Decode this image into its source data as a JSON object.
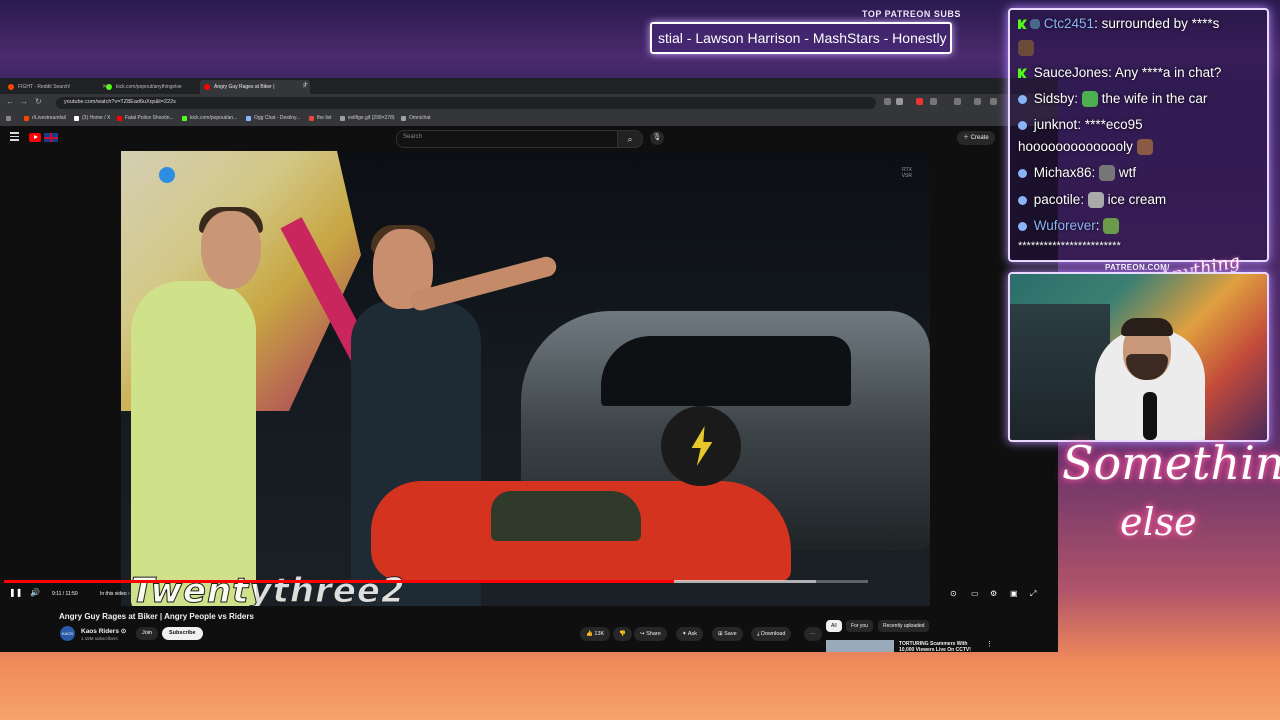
{
  "overlay": {
    "top_patreon_label": "TOP PATREON SUBS",
    "ticker_text": "stial - Lawson Harrison - MashStars - Honestly",
    "patreon_url": "PATREON.COM/",
    "brand_small": "Anything else",
    "brand_line1": "Something",
    "brand_line2": "else"
  },
  "browser": {
    "tabs": [
      {
        "label": "FIGHT - Reddit Search!",
        "color": "#ff4500"
      },
      {
        "label": "kick.com/popout/anythingelse",
        "color": "#53fc18"
      },
      {
        "label": "Angry Guy Rages at Biker | ",
        "color": "#ff0000"
      }
    ],
    "url": "youtube.com/watch?v=TZ8Ead6uXqs&t=222s",
    "bookmarks": [
      {
        "label": "r/Livestreamfail",
        "color": "#ff4500"
      },
      {
        "label": "(3) Home / X",
        "color": "#ffffff"
      },
      {
        "label": "Fatal Police Shootin...",
        "color": "#ff0000"
      },
      {
        "label": "kick.com/popout/an...",
        "color": "#53fc18"
      },
      {
        "label": "Ogg Chat - Destiny...",
        "color": "#8ab4f8"
      },
      {
        "label": "the list",
        "color": "#e8453c"
      },
      {
        "label": "evilfige.gif (299×278)",
        "color": "#9aa0a6"
      },
      {
        "label": "Omnichat",
        "color": "#9aa0a6"
      }
    ]
  },
  "youtube": {
    "search_placeholder": "Search",
    "create_label": "Create",
    "player": {
      "time": "9:11 / 11:50",
      "in_this_video": "In this video ›",
      "progress": 0.776,
      "buffered": 0.94,
      "watermark": "Twentythree2",
      "rtx_badge": "RTX\nVSR"
    },
    "video_title": "Angry Guy Rages at Biker | Angry People vs Riders",
    "channel": {
      "name": "Kaos Riders ⊙",
      "subscribers": "1.15M subscribers",
      "avatar_text": "KAOS",
      "join_label": "Join",
      "subscribe_label": "Subscribe"
    },
    "actions": {
      "likes": "13K",
      "share": "Share",
      "ask": "Ask",
      "save": "Save",
      "download": "Download",
      "more": "···"
    },
    "chips": [
      "All",
      "For you",
      "Recently uploaded"
    ],
    "recommended": {
      "title": "TORTURING Scammers With 10,000 Viewers Live On CCTV!"
    }
  },
  "chat": {
    "messages": [
      {
        "badge": "kick",
        "user": "Ctc2451",
        "user_color": "#8ab4f8",
        "text": "surrounded by ****s",
        "emote": ""
      },
      {
        "badge": "",
        "user": "",
        "user_color": "#ffffff",
        "text": "",
        "emote": "#6b4a3a"
      },
      {
        "badge": "kick",
        "user": "SauceJones",
        "user_color": "#ffffff",
        "text": "Any ****a in chat?",
        "emote": ""
      },
      {
        "badge": "twitch",
        "user": "Sidsby",
        "user_color": "#ffffff",
        "text": "the wife in the car",
        "emote": "#4caf50"
      },
      {
        "badge": "twitch",
        "user": "junknot",
        "user_color": "#ffffff",
        "text": "****eco95",
        "emote": ""
      },
      {
        "badge": "",
        "user": "",
        "user_color": "#ffffff",
        "text": "hoooooooooooooly",
        "emote": "#8a5a44"
      },
      {
        "badge": "twitch",
        "user": "Michax86",
        "user_color": "#ffffff",
        "text": "wtf",
        "emote": "#777777"
      },
      {
        "badge": "twitch",
        "user": "pacotile",
        "user_color": "#ffffff",
        "text": "ice cream",
        "emote": "#aaaaaa"
      },
      {
        "badge": "twitch",
        "user": "Wuforever",
        "user_color": "#8ab4f8",
        "text": "",
        "emote": "#6a9a4a"
      },
      {
        "badge": "",
        "user": "",
        "user_color": "#ffffff",
        "text": "************************",
        "emote": ""
      }
    ]
  }
}
